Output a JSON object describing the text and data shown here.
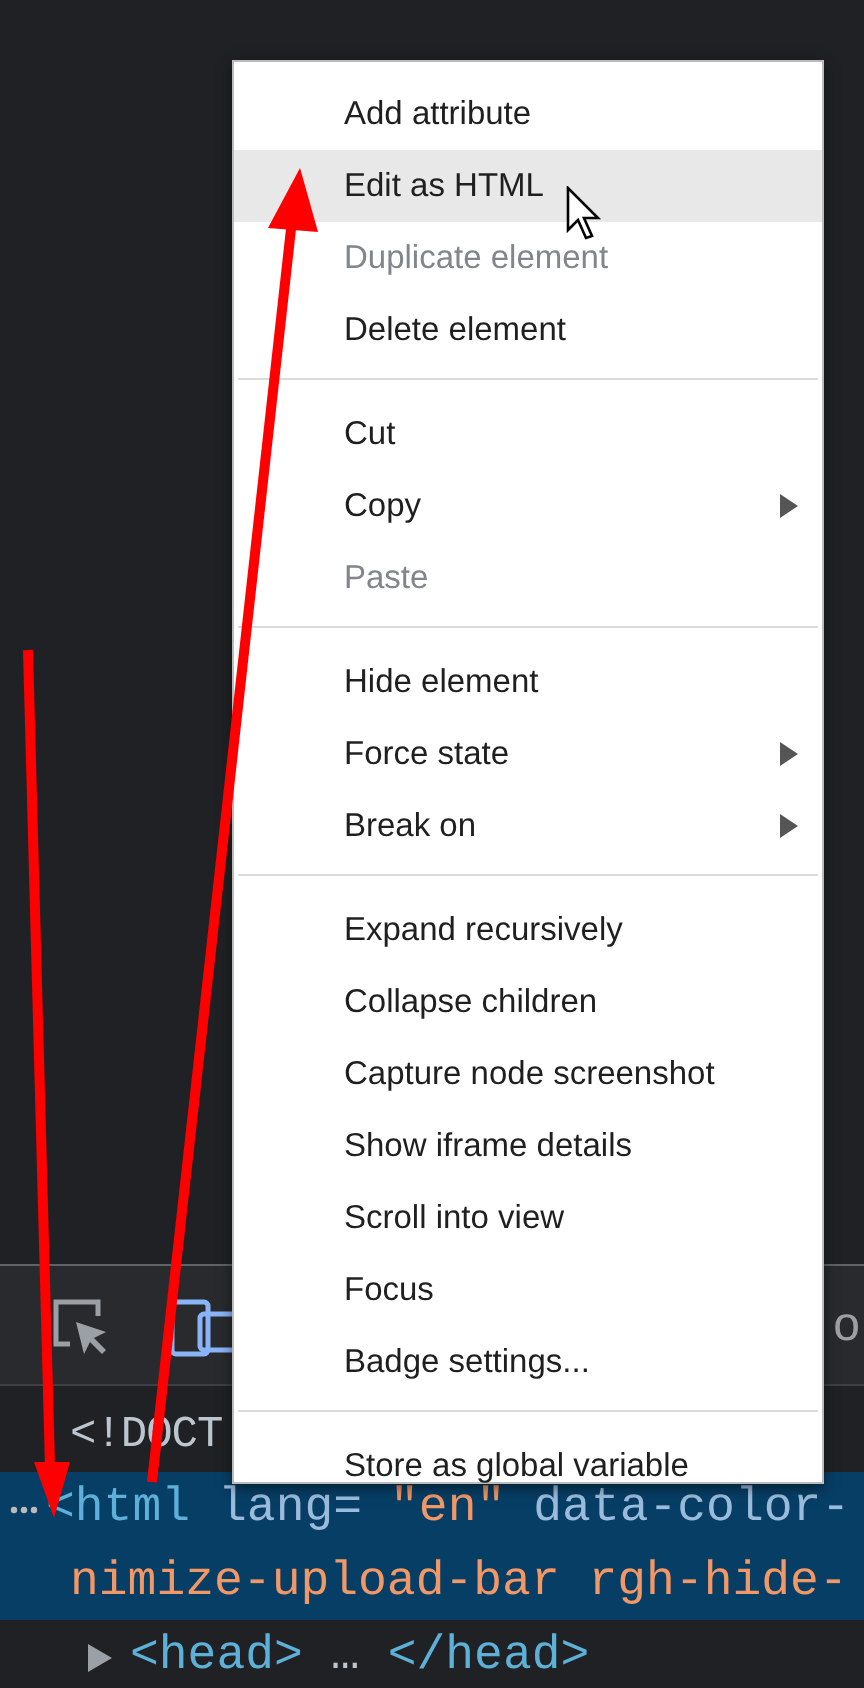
{
  "toolbar": {
    "tools": [
      {
        "kind": "inspect",
        "selected": false
      },
      {
        "kind": "device",
        "selected": true
      }
    ],
    "tab_fragment": "o"
  },
  "dom_tree": [
    {
      "kind": "doctype",
      "selected": false,
      "tokens": [
        {
          "kind": "text",
          "text": "<!DOCT"
        }
      ]
    },
    {
      "kind": "element",
      "selected": true,
      "tokens": [
        {
          "kind": "tag",
          "text": "<html"
        },
        {
          "kind": "attr",
          "text": "lang="
        },
        {
          "kind": "value",
          "text": "\"en\""
        },
        {
          "kind": "attr",
          "text": "data-color-"
        }
      ],
      "continuation": "nimize-upload-bar rgh-hide-"
    },
    {
      "kind": "element",
      "selected": false,
      "expanded": false,
      "tokens": [
        {
          "kind": "tag",
          "text": "<head>"
        },
        {
          "kind": "text",
          "text": "…"
        },
        {
          "kind": "tag",
          "text": "</head>"
        }
      ]
    }
  ],
  "context_menu": {
    "groups": [
      [
        {
          "label": "Add attribute",
          "disabled": false,
          "submenu": false,
          "selected": false
        },
        {
          "label": "Edit as HTML",
          "disabled": false,
          "submenu": false,
          "selected": true
        },
        {
          "label": "Duplicate element",
          "disabled": true,
          "submenu": false,
          "selected": false
        },
        {
          "label": "Delete element",
          "disabled": false,
          "submenu": false,
          "selected": false
        }
      ],
      [
        {
          "label": "Cut",
          "disabled": false,
          "submenu": false,
          "selected": false
        },
        {
          "label": "Copy",
          "disabled": false,
          "submenu": true,
          "selected": false
        },
        {
          "label": "Paste",
          "disabled": true,
          "submenu": false,
          "selected": false
        }
      ],
      [
        {
          "label": "Hide element",
          "disabled": false,
          "submenu": false,
          "selected": false
        },
        {
          "label": "Force state",
          "disabled": false,
          "submenu": true,
          "selected": false
        },
        {
          "label": "Break on",
          "disabled": false,
          "submenu": true,
          "selected": false
        }
      ],
      [
        {
          "label": "Expand recursively",
          "disabled": false,
          "submenu": false,
          "selected": false
        },
        {
          "label": "Collapse children",
          "disabled": false,
          "submenu": false,
          "selected": false
        },
        {
          "label": "Capture node screenshot",
          "disabled": false,
          "submenu": false,
          "selected": false
        },
        {
          "label": "Show iframe details",
          "disabled": false,
          "submenu": false,
          "selected": false
        },
        {
          "label": "Scroll into view",
          "disabled": false,
          "submenu": false,
          "selected": false
        },
        {
          "label": "Focus",
          "disabled": false,
          "submenu": false,
          "selected": false
        },
        {
          "label": "Badge settings...",
          "disabled": false,
          "submenu": false,
          "selected": false
        }
      ],
      [
        {
          "label": "Store as global variable",
          "disabled": false,
          "submenu": false,
          "selected": false
        }
      ]
    ]
  }
}
